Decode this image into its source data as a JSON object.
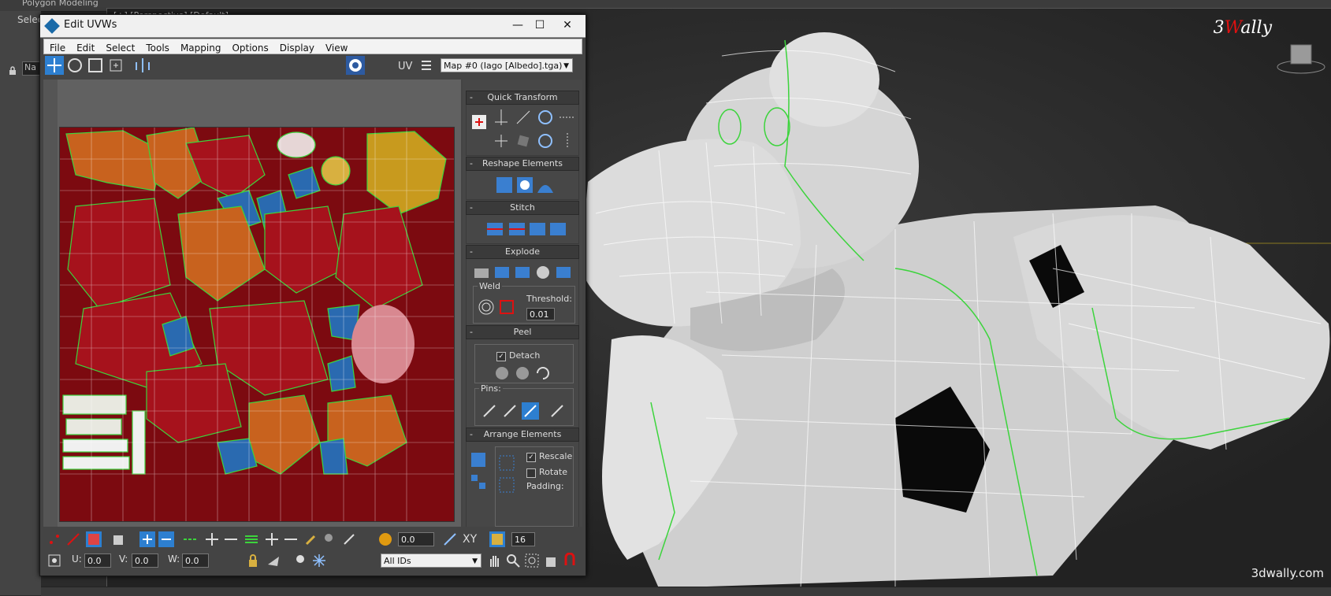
{
  "app": {
    "top_label": "Polygon Modeling",
    "left_label": "Selec",
    "name_box": "Na"
  },
  "viewport": {
    "label": "[+] [Perspective] [Default]",
    "watermark": "3dwally.com",
    "logo_three": "3",
    "logo_v": "W",
    "logo_rest": "ally"
  },
  "window": {
    "title": "Edit UVWs",
    "minimize": "—",
    "maximize": "☐",
    "close": "✕"
  },
  "menu": [
    "File",
    "Edit",
    "Select",
    "Tools",
    "Mapping",
    "Options",
    "Display",
    "View"
  ],
  "toolbar": {
    "uv_label": "UV",
    "map_select": "Map #0 (Iago [Albedo].tga)"
  },
  "panel": {
    "quick_transform": "Quick Transform",
    "reshape": "Reshape Elements",
    "stitch": "Stitch",
    "explode": "Explode",
    "weld": "Weld",
    "threshold_label": "Threshold:",
    "threshold_value": "0.01",
    "peel": "Peel",
    "detach": "Detach",
    "pins": "Pins:",
    "arrange": "Arrange Elements",
    "rescale": "Rescale",
    "rotate": "Rotate",
    "padding": "Padding:"
  },
  "bottom": {
    "spin_value": "0.0",
    "xy_label": "XY",
    "count": "16",
    "u_label": "U:",
    "u_value": "0.0",
    "v_label": "V:",
    "v_value": "0.0",
    "w_label": "W:",
    "w_value": "0.0",
    "ids": "All IDs"
  },
  "colors": {
    "uv_bg": "#7c0a10",
    "orange": "#c8621e",
    "gold": "#c89a1e",
    "blue": "#2a6ab0",
    "seam": "#3cd43c"
  }
}
